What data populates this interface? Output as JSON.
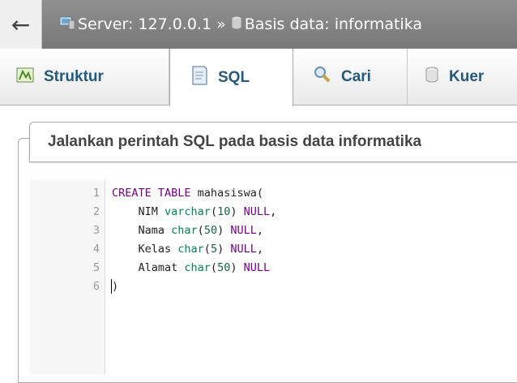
{
  "breadcrumb": {
    "server": "Server: 127.0.0.1",
    "separator": "»",
    "database": "Basis data: informatika"
  },
  "tabs": [
    {
      "label": "Struktur",
      "icon": "structure-icon"
    },
    {
      "label": "SQL",
      "icon": "sql-icon",
      "active": true
    },
    {
      "label": "Cari",
      "icon": "search-icon"
    },
    {
      "label": "Kuer",
      "icon": "query-icon"
    }
  ],
  "panel": {
    "title": "Jalankan perintah SQL pada basis data informatika"
  },
  "editor": {
    "lines": [
      {
        "n": "1",
        "parts": [
          [
            "kw",
            "CREATE TABLE"
          ],
          [
            "tx",
            " mahasiswa("
          ]
        ]
      },
      {
        "n": "2",
        "parts": [
          [
            "tx",
            "    NIM "
          ],
          [
            "ty",
            "varchar"
          ],
          [
            "tx",
            "("
          ],
          [
            "num",
            "10"
          ],
          [
            "tx",
            ") "
          ],
          [
            "null",
            "NULL"
          ],
          [
            "tx",
            ","
          ]
        ]
      },
      {
        "n": "3",
        "parts": [
          [
            "tx",
            "    Nama "
          ],
          [
            "ty",
            "char"
          ],
          [
            "tx",
            "("
          ],
          [
            "num",
            "50"
          ],
          [
            "tx",
            ") "
          ],
          [
            "null",
            "NULL"
          ],
          [
            "tx",
            ","
          ]
        ]
      },
      {
        "n": "4",
        "parts": [
          [
            "tx",
            "    Kelas "
          ],
          [
            "ty",
            "char"
          ],
          [
            "tx",
            "("
          ],
          [
            "num",
            "5"
          ],
          [
            "tx",
            ") "
          ],
          [
            "null",
            "NULL"
          ],
          [
            "tx",
            ","
          ]
        ]
      },
      {
        "n": "5",
        "parts": [
          [
            "tx",
            "    Alamat "
          ],
          [
            "ty",
            "char"
          ],
          [
            "tx",
            "("
          ],
          [
            "num",
            "50"
          ],
          [
            "tx",
            ") "
          ],
          [
            "null",
            "NULL"
          ]
        ]
      },
      {
        "n": "6",
        "parts": [
          [
            "tx",
            ")"
          ]
        ]
      }
    ]
  },
  "colors": {
    "link": "#235a81",
    "keyword": "#770088",
    "type": "#008855"
  }
}
